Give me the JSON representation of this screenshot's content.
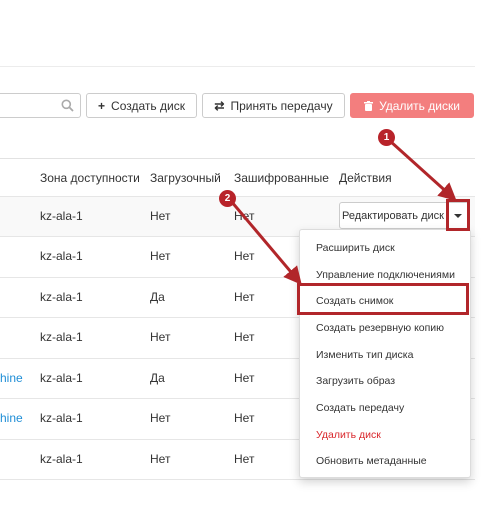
{
  "toolbar": {
    "create_disk": "Создать диск",
    "accept_transfer": "Принять передачу",
    "delete_disks": "Удалить диски"
  },
  "table": {
    "headers": [
      "Зона доступности",
      "Загрузочный",
      "Зашифрованные",
      "Действия"
    ],
    "rows": [
      {
        "name": "",
        "zone": "kz-ala-1",
        "bootable": "Нет",
        "encrypted": "Нет"
      },
      {
        "name": "",
        "zone": "kz-ala-1",
        "bootable": "Нет",
        "encrypted": "Нет"
      },
      {
        "name": "",
        "zone": "kz-ala-1",
        "bootable": "Да",
        "encrypted": "Нет"
      },
      {
        "name": "",
        "zone": "kz-ala-1",
        "bootable": "Нет",
        "encrypted": "Нет"
      },
      {
        "name": "hine",
        "zone": "kz-ala-1",
        "bootable": "Да",
        "encrypted": "Нет"
      },
      {
        "name": "hine",
        "zone": "kz-ala-1",
        "bootable": "Нет",
        "encrypted": "Нет"
      },
      {
        "name": "",
        "zone": "kz-ala-1",
        "bootable": "Нет",
        "encrypted": "Нет"
      }
    ]
  },
  "actions": {
    "edit_disk": "Редактировать диск"
  },
  "dropdown": {
    "items": [
      "Расширить диск",
      "Управление подключениями",
      "Создать снимок",
      "Создать резервную копию",
      "Изменить тип диска",
      "Загрузить образ",
      "Создать передачу",
      "Удалить диск",
      "Обновить метаданные"
    ]
  },
  "annotations": {
    "step1": "1",
    "step2": "2"
  },
  "colors": {
    "danger_button": "#f37e7e",
    "link": "#1f8ed6",
    "annotation": "#b1262a",
    "danger_text": "#d9262b"
  }
}
